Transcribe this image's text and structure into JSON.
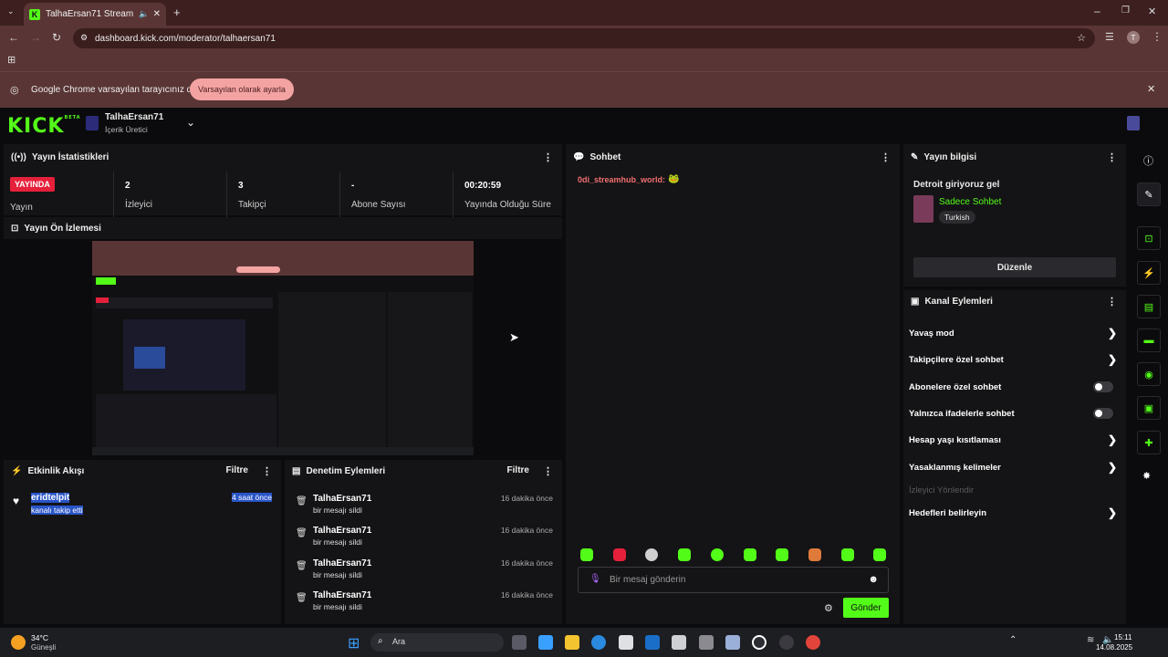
{
  "browser": {
    "tab_title": "TalhaErsan71 Stream - Kick",
    "url": "dashboard.kick.com/moderator/talhaersan71",
    "infobar_message": "Google Chrome varsayılan tarayıcınız değil",
    "infobar_button": "Varsayılan olarak ayarla",
    "profile_initial": "T"
  },
  "header": {
    "logo": "KICK",
    "logo_badge": "BETA",
    "channel_name": "TalhaErsan71",
    "channel_role": "İçerik Üretici"
  },
  "stats": {
    "title": "Yayın İstatistikleri",
    "live_badge": "YAYINDA",
    "live_label": "Yayın",
    "items": [
      {
        "value": "2",
        "label": "İzleyici"
      },
      {
        "value": "3",
        "label": "Takipçi"
      },
      {
        "value": "-",
        "label": "Abone Sayısı"
      },
      {
        "value": "00:20:59",
        "label": "Yayında Olduğu Süre"
      }
    ]
  },
  "preview": {
    "title": "Yayın Ön İzlemesi"
  },
  "activity": {
    "title": "Etkinlik Akışı",
    "filter": "Filtre",
    "items": [
      {
        "user": "eridtelpit",
        "action": "kanalı takip etti",
        "time": "4 saat önce"
      }
    ]
  },
  "modlog": {
    "title": "Denetim Eylemleri",
    "filter": "Filtre",
    "items": [
      {
        "user": "TalhaErsan71",
        "action": "bir mesajı sildi",
        "time": "16 dakika önce"
      },
      {
        "user": "TalhaErsan71",
        "action": "bir mesajı sildi",
        "time": "16 dakika önce"
      },
      {
        "user": "TalhaErsan71",
        "action": "bir mesajı sildi",
        "time": "16 dakika önce"
      },
      {
        "user": "TalhaErsan71",
        "action": "bir mesajı sildi",
        "time": "16 dakika önce"
      }
    ]
  },
  "chat": {
    "title": "Sohbet",
    "messages": [
      {
        "user": "0di_streamhub_world:",
        "emote": "🐸"
      }
    ],
    "input_placeholder": "Bir mesaj gönderin",
    "send_label": "Gönder"
  },
  "streaminfo": {
    "title": "Yayın bilgisi",
    "stream_title": "Detroit giriyoruz gel",
    "category": "Sadece Sohbet",
    "language_tag": "Turkish",
    "edit_label": "Düzenle"
  },
  "channel_actions": {
    "title": "Kanal Eylemleri",
    "items": [
      {
        "label": "Yavaş mod",
        "control": "chevron"
      },
      {
        "label": "Takipçilere özel sohbet",
        "control": "chevron"
      },
      {
        "label": "Abonelere özel sohbet",
        "control": "toggle"
      },
      {
        "label": "Yalnızca ifadelerle sohbet",
        "control": "toggle"
      },
      {
        "label": "Hesap yaşı kısıtlaması",
        "control": "chevron"
      },
      {
        "label": "Yasaklanmış kelimeler",
        "control": "chevron"
      },
      {
        "label": "İzleyici Yönlendir",
        "control": "disabled"
      },
      {
        "label": "Hedefleri belirleyin",
        "control": "chevron"
      }
    ]
  },
  "taskbar": {
    "weather_temp": "34°C",
    "weather_desc": "Güneşli",
    "search_label": "Ara",
    "time": "15:11",
    "date": "14.08.2025"
  },
  "colors": {
    "accent": "#53fc18",
    "live": "#e5203a",
    "panel": "#141416"
  }
}
